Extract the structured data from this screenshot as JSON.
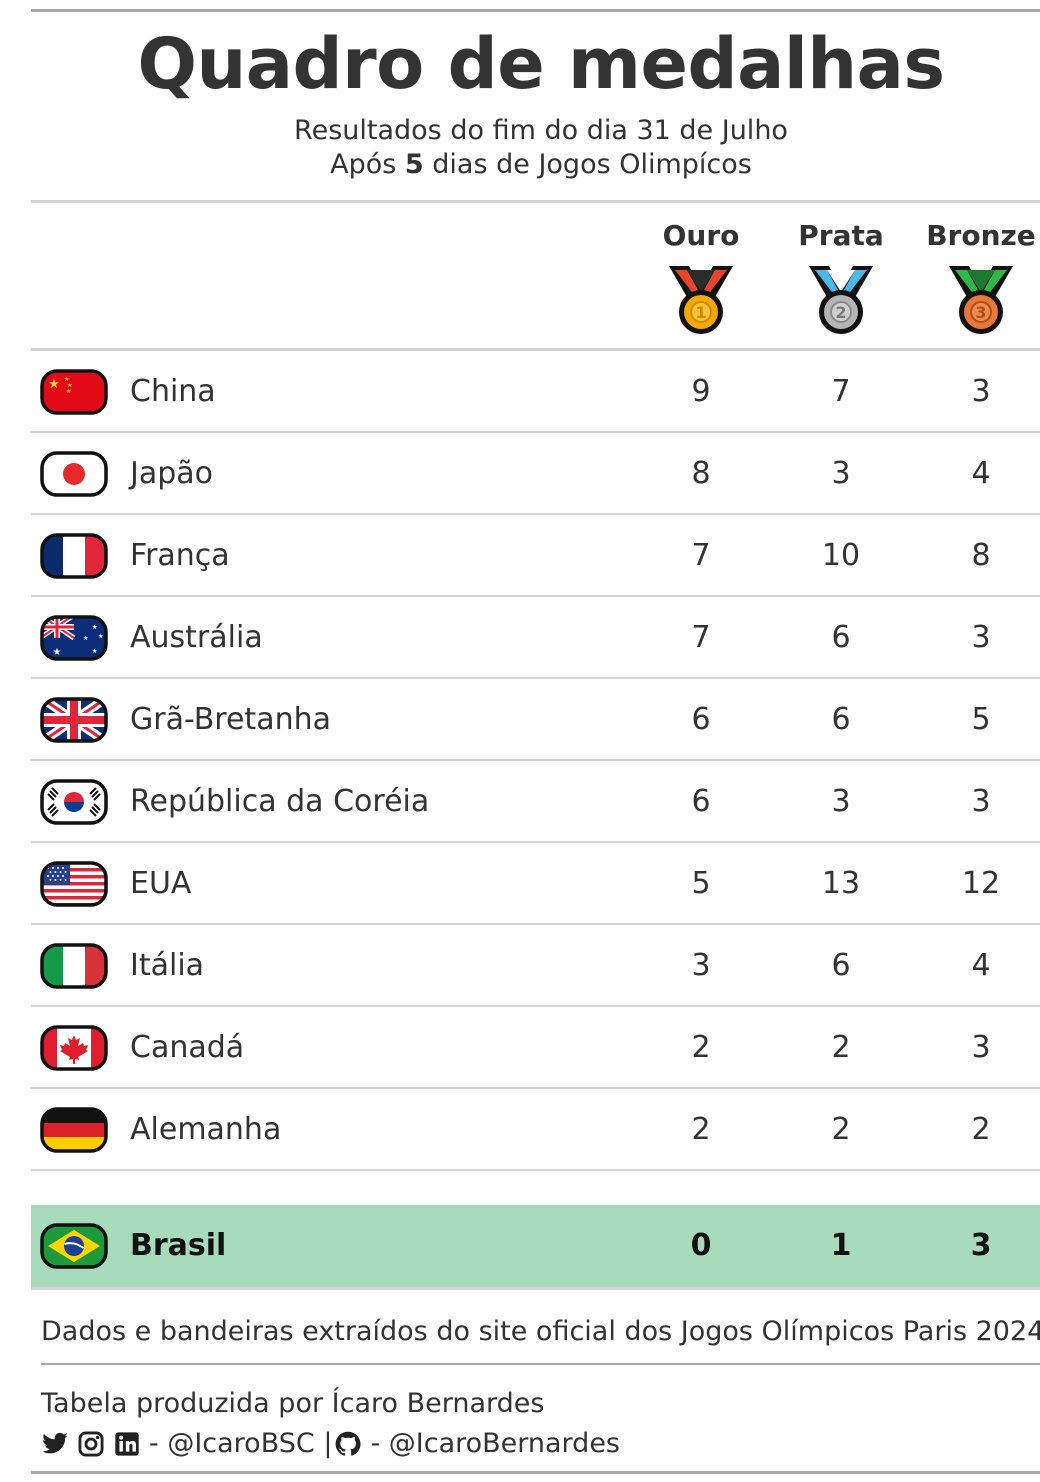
{
  "header": {
    "title": "Quadro de medalhas",
    "subtitle_line1": "Resultados do fim do dia 31 de Julho",
    "subtitle_line2_pre": "Após ",
    "subtitle_line2_days": "5",
    "subtitle_line2_post": " dias de Jogos Olimpícos"
  },
  "columns": {
    "gold": "Ouro",
    "silver": "Prata",
    "bronze": "Bronze"
  },
  "rows": [
    {
      "country": "China",
      "gold": "9",
      "silver": "7",
      "bronze": "3"
    },
    {
      "country": "Japão",
      "gold": "8",
      "silver": "3",
      "bronze": "4"
    },
    {
      "country": "França",
      "gold": "7",
      "silver": "10",
      "bronze": "8"
    },
    {
      "country": "Austrália",
      "gold": "7",
      "silver": "6",
      "bronze": "3"
    },
    {
      "country": "Grã-Bretanha",
      "gold": "6",
      "silver": "6",
      "bronze": "5"
    },
    {
      "country": "República da Coréia",
      "gold": "6",
      "silver": "3",
      "bronze": "3"
    },
    {
      "country": "EUA",
      "gold": "5",
      "silver": "13",
      "bronze": "12"
    },
    {
      "country": "Itália",
      "gold": "3",
      "silver": "6",
      "bronze": "4"
    },
    {
      "country": "Canadá",
      "gold": "2",
      "silver": "2",
      "bronze": "3"
    },
    {
      "country": "Alemanha",
      "gold": "2",
      "silver": "2",
      "bronze": "2"
    }
  ],
  "highlight": {
    "country": "Brasil",
    "gold": "0",
    "silver": "1",
    "bronze": "3"
  },
  "footer": {
    "source": "Dados e bandeiras extraídos do site oficial dos Jogos Olímpicos Paris 2024",
    "credit": "Tabela produzida por Ícaro Bernardes",
    "social_handle_1": " - @IcaroBSC | ",
    "social_handle_2": " - @IcaroBernardes"
  },
  "colors": {
    "highlight_row": "#a8dabc",
    "text": "#333333"
  }
}
